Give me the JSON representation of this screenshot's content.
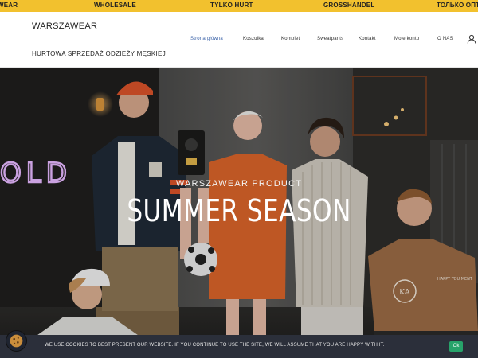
{
  "ticker": {
    "items": [
      "WEAR",
      "WHOLESALE",
      "TYLKO HURT",
      "GROSSHANDEL",
      "ТОЛЬКО ОПТ"
    ]
  },
  "header": {
    "logo": "WARSZAWEAR",
    "tagline": "HURTOWA SPRZEDAŻ ODZIEŻY MĘSKIEJ",
    "nav": [
      "Strona główna",
      "Koszulka",
      "Komplet",
      "Sweatpants",
      "Kontakt",
      "Moje konto",
      "O NAS"
    ]
  },
  "hero": {
    "neon_sign": "OLD",
    "subtitle": "WARSZAWEAR PRODUCT",
    "title": "SUMMER SEASON",
    "shirt_print": "KA",
    "shirt_print_2": "HAPPY YOU MENT"
  },
  "cookie": {
    "text": "WE USE COOKIES TO BEST PRESENT OUR WEBSITE. IF YOU CONTINUE TO USE THE SITE, WE WILL ASSUME THAT YOU ARE HAPPY WITH IT.",
    "ok_label": "Ok"
  },
  "colors": {
    "ticker_bg": "#f2c12e",
    "nav_active": "#3a62a8",
    "cookie_bg": "#2b2f3a",
    "ok_button": "#27a36a",
    "neon": "#e6b8ff"
  },
  "icons": {
    "account": "user-icon",
    "cookie": "cookie-badge-icon"
  }
}
